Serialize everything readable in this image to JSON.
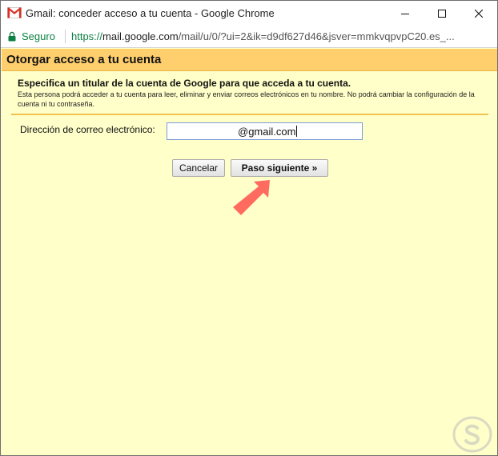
{
  "window": {
    "title": "Gmail: conceder acceso a tu cuenta - Google Chrome",
    "icon": "gmail-icon",
    "controls": [
      "minimize-icon",
      "maximize-icon",
      "close-icon"
    ]
  },
  "addressbar": {
    "secure_label": "Seguro",
    "url_scheme": "https://",
    "url_host": "mail.google.com",
    "url_rest": "/mail/u/0/?ui=2&ik=d9df627d46&jsver=mmkvqpvpC20.es_..."
  },
  "dialog": {
    "title": "Otorgar acceso a tu cuenta",
    "heading": "Especifica un titular de la cuenta de Google para que acceda a tu cuenta.",
    "description": "Esta persona podrá acceder a tu cuenta para leer, eliminar y enviar correos electrónicos en tu nombre. No podrá cambiar la configuración de la cuenta ni tu contraseña.",
    "email_label": "Dirección de correo electrónico:",
    "email_value": "@gmail.com",
    "cancel_label": "Cancelar",
    "next_label": "Paso siguiente »"
  },
  "colors": {
    "header_bg": "#ffcf6e",
    "body_bg": "#ffffc9",
    "secure_green": "#0b8043",
    "arrow": "#ff6b5e"
  }
}
